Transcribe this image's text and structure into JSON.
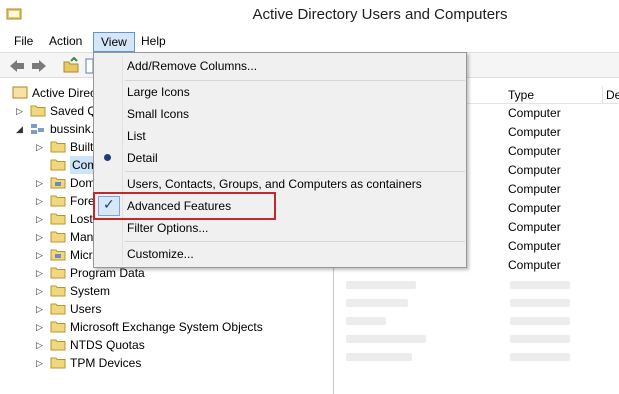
{
  "window": {
    "title": "Active Directory Users and Computers"
  },
  "menu": {
    "file": "File",
    "action": "Action",
    "view": "View",
    "help": "Help"
  },
  "tree": {
    "root": "Active Directo",
    "saved": "Saved Q",
    "domain": "bussink.",
    "items": [
      "Built",
      "Com",
      "Dom",
      "Fore",
      "Lost",
      "Man",
      "Micr",
      "Program Data",
      "System",
      "Users",
      "Microsoft Exchange System Objects",
      "NTDS Quotas",
      "TPM Devices"
    ]
  },
  "list": {
    "columns": {
      "type": "Type",
      "desc": "De"
    },
    "rows": [
      "Computer",
      "Computer",
      "Computer",
      "Computer",
      "Computer",
      "Computer",
      "Computer",
      "Computer",
      "Computer"
    ]
  },
  "view_menu": {
    "add_remove_columns": "Add/Remove Columns...",
    "large_icons": "Large Icons",
    "small_icons": "Small Icons",
    "list": "List",
    "detail": "Detail",
    "containers": "Users, Contacts, Groups, and Computers as containers",
    "advanced_features": "Advanced Features",
    "filter_options": "Filter Options...",
    "customize": "Customize..."
  },
  "colors": {
    "highlight": "#c0282d",
    "selection": "#d5e6f7"
  }
}
